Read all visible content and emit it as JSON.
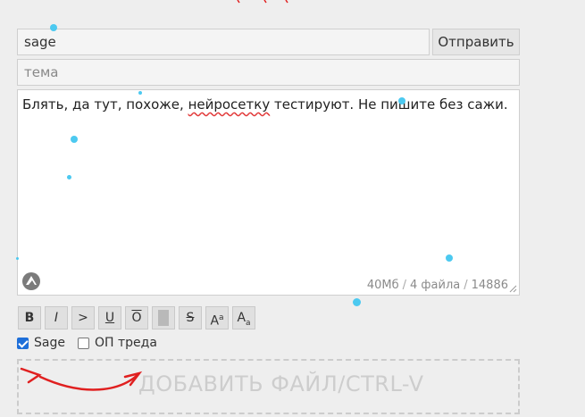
{
  "form": {
    "email_value": "sage",
    "send_label": "Отправить",
    "subject_placeholder": "тема",
    "comment": {
      "before": "Блять, да тут, похоже, ",
      "misspelled": "нейросетку",
      "after": " тестируют. Не пишите без сажи."
    },
    "counter": {
      "size": "40Мб",
      "files": "4 файла",
      "chars": "14886"
    }
  },
  "markup": {
    "bold": "B",
    "italic": "I",
    "quote": ">",
    "underline": "U",
    "overline": "O",
    "strike": "S",
    "sup": {
      "base": "A",
      "small": "a"
    },
    "sub": {
      "base": "A",
      "small": "a"
    }
  },
  "options": {
    "sage": {
      "label": "Sage",
      "checked": true
    },
    "op": {
      "label": "ОП треда",
      "checked": false
    }
  },
  "dropzone": {
    "label": "ДОБАВИТЬ ФАЙЛ/CTRL-V"
  },
  "icons": [
    "logo-icon",
    "resize-grip-icon",
    "checkbox-icon",
    "red-arrow-annotation"
  ],
  "colors": {
    "accent": "#1e6fd9",
    "dots": "#4cc9f0",
    "annotation": "#e02020",
    "spellcheck": "#e23b3b"
  }
}
